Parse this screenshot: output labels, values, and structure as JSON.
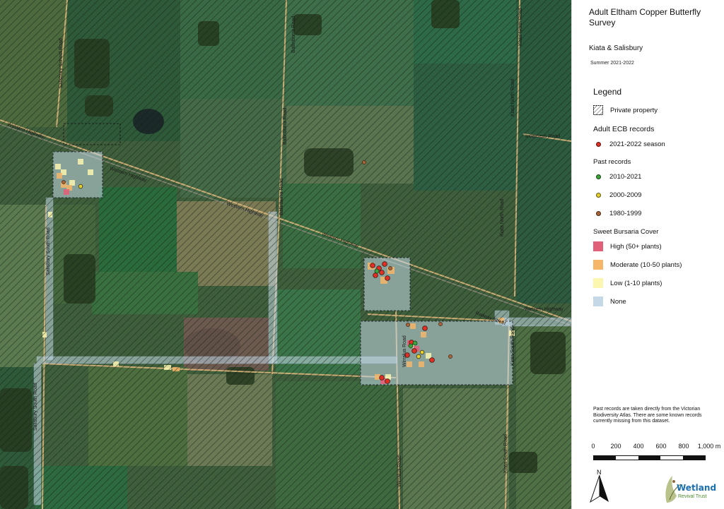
{
  "map": {
    "roads": {
      "western_hwy_1": "Western Highway",
      "western_hwy_2": "Western Highway",
      "western_hwy_3": "Western Highway",
      "western_hwy_4": "Western Highway",
      "salisbury_road": "Salisbury School Road",
      "salisbury_south_1": "Salisbury South Road",
      "salisbury_south_2": "Salisbury South Road",
      "salisbury_south_3": "Salisbury South Road",
      "ballinburra_1": "Ballinburra Road",
      "ballinburra_2": "Ballinburra Road",
      "ballinburra_3": "Ballinburra Road",
      "kiata_north_1": "Kiata North Road",
      "kiata_north_2": "Kiata North Road",
      "kiata_north_3": "Kiata North Road",
      "kiata_south_1": "Kiata South Road",
      "kiata_south_2": "Kiata South Road",
      "inverness": "Inverness Road",
      "railway": "Railway Street",
      "wirralua": "Wirralua Road"
    }
  },
  "panel": {
    "title": "Adult Eltham Copper Butterfly Survey",
    "subtitle": "Kiata & Salisbury",
    "season": "Summer 2021-2022",
    "legend_heading": "Legend",
    "private_property": "Private property",
    "adult_records_heading": "Adult ECB records",
    "season_2021": "2021-2022 season",
    "past_records_heading": "Past records",
    "rec_2010": "2010-2021",
    "rec_2000": "2000-2009",
    "rec_1980": "1980-1999",
    "bursaria_heading": "Sweet Bursaria Cover",
    "high": "High (50+ plants)",
    "moderate": "Moderate (10-50 plants)",
    "low": "Low (1-10 plants)",
    "none": "None",
    "note": "Past records are taken directly from the Victorian Biodiversity Atlas. There are some known records currently missing from this dataset.",
    "scale": [
      "0",
      "200",
      "400",
      "600",
      "800",
      "1,000 m"
    ],
    "north": "N",
    "logo_line1": "Wetland",
    "logo_line2": "Revival Trust"
  },
  "colors": {
    "record_2021": "#e03025",
    "record_2010": "#3aa33a",
    "record_2000": "#e6d22a",
    "record_1980": "#a9643a",
    "high": "#e0607a",
    "moderate": "#f5b66a",
    "low": "#fbf6b0",
    "none": "#c5d8e8"
  }
}
